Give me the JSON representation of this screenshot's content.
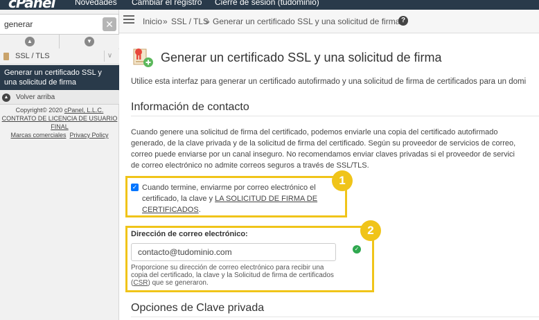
{
  "topbar": {
    "logo": "cPanel",
    "nav": [
      "Novedades",
      "Cambiar el registro",
      "Cierre de sesión (tudominio)"
    ]
  },
  "sidebar": {
    "search_value": "generar",
    "clear_label": "✕",
    "category_label": "SSL / TLS",
    "active_item": "Generar un certificado SSL y una solicitud de firma",
    "back_top": "Volver arriba",
    "footer": {
      "copyright": "Copyright© 2020 ",
      "company": "cPanel, L.L.C.",
      "license": "CONTRATO DE LICENCIA DE USUARIO FINAL",
      "trademarks": "Marcas comerciales",
      "privacy": "Privacy Policy"
    }
  },
  "breadcrumb": {
    "home": "Inicio",
    "sep": "»",
    "section": "SSL / TLS",
    "current": "Generar un certificado SSL y una solicitud de firma"
  },
  "main": {
    "title": "Generar un certificado SSL y una solicitud de firma",
    "intro": "Utilice esta interfaz para generar un certificado autofirmado y una solicitud de firma de certificados para un domi",
    "contact_title": "Información de contacto",
    "desc_lines": [
      "Cuando genere una solicitud de firma del certificado, podemos enviarle una copia del certificado autofirmado",
      "generado, de la clave privada y de la solicitud de firma del certificado. Según su proveedor de servicios de correo,",
      "correo puede enviarse por un canal inseguro. No recomendamos enviar claves privadas si el proveedor de servici",
      "de correo electrónico no admite correos seguros a través de SSL/TLS."
    ],
    "checkbox_label_pre": "Cuando termine, enviarme por correo electrónico el certificado, la clave y ",
    "checkbox_label_link": "LA SOLICITUD DE FIRMA DE CERTIFICADOS",
    "checkbox_label_post": ".",
    "badge1": "1",
    "badge2": "2",
    "email_label": "Dirección de correo electrónico:",
    "email_value": "contacto@tudominio.com",
    "email_help_pre": "Proporcione su dirección de correo electrónico para recibir una copia del certificado, la clave y la Solicitud de firma de certificados (",
    "email_help_abbr": "CSR",
    "email_help_post": ") que se generaron.",
    "key_title": "Opciones de Clave privada"
  },
  "colors": {
    "highlight": "#f0c419",
    "nav_bg": "#293a4a",
    "ok": "#2fa84f"
  }
}
